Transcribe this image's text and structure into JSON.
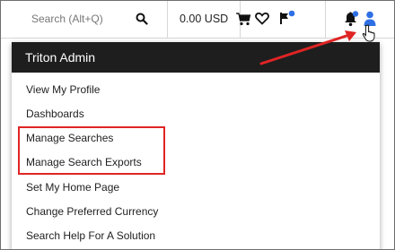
{
  "search": {
    "placeholder": "Search (Alt+Q)"
  },
  "cart": {
    "amount": "0.00 USD"
  },
  "user_menu": {
    "header": "Triton Admin",
    "items": [
      {
        "label": "View My Profile"
      },
      {
        "label": "Dashboards"
      },
      {
        "label": "Manage Searches"
      },
      {
        "label": "Manage Search Exports"
      },
      {
        "label": "Set My Home Page"
      },
      {
        "label": "Change Preferred Currency"
      },
      {
        "label": "Search Help For A Solution"
      }
    ]
  },
  "icons": {
    "search": "search-icon",
    "cart": "cart-icon",
    "favorites": "heart-icon",
    "flag": "flag-icon",
    "notifications": "bell-icon",
    "user": "user-icon"
  },
  "colors": {
    "header_bg": "#1e1e1e",
    "badge": "#2f6fe4",
    "annotation": "#e02424",
    "user_icon": "#2f6fe4"
  }
}
